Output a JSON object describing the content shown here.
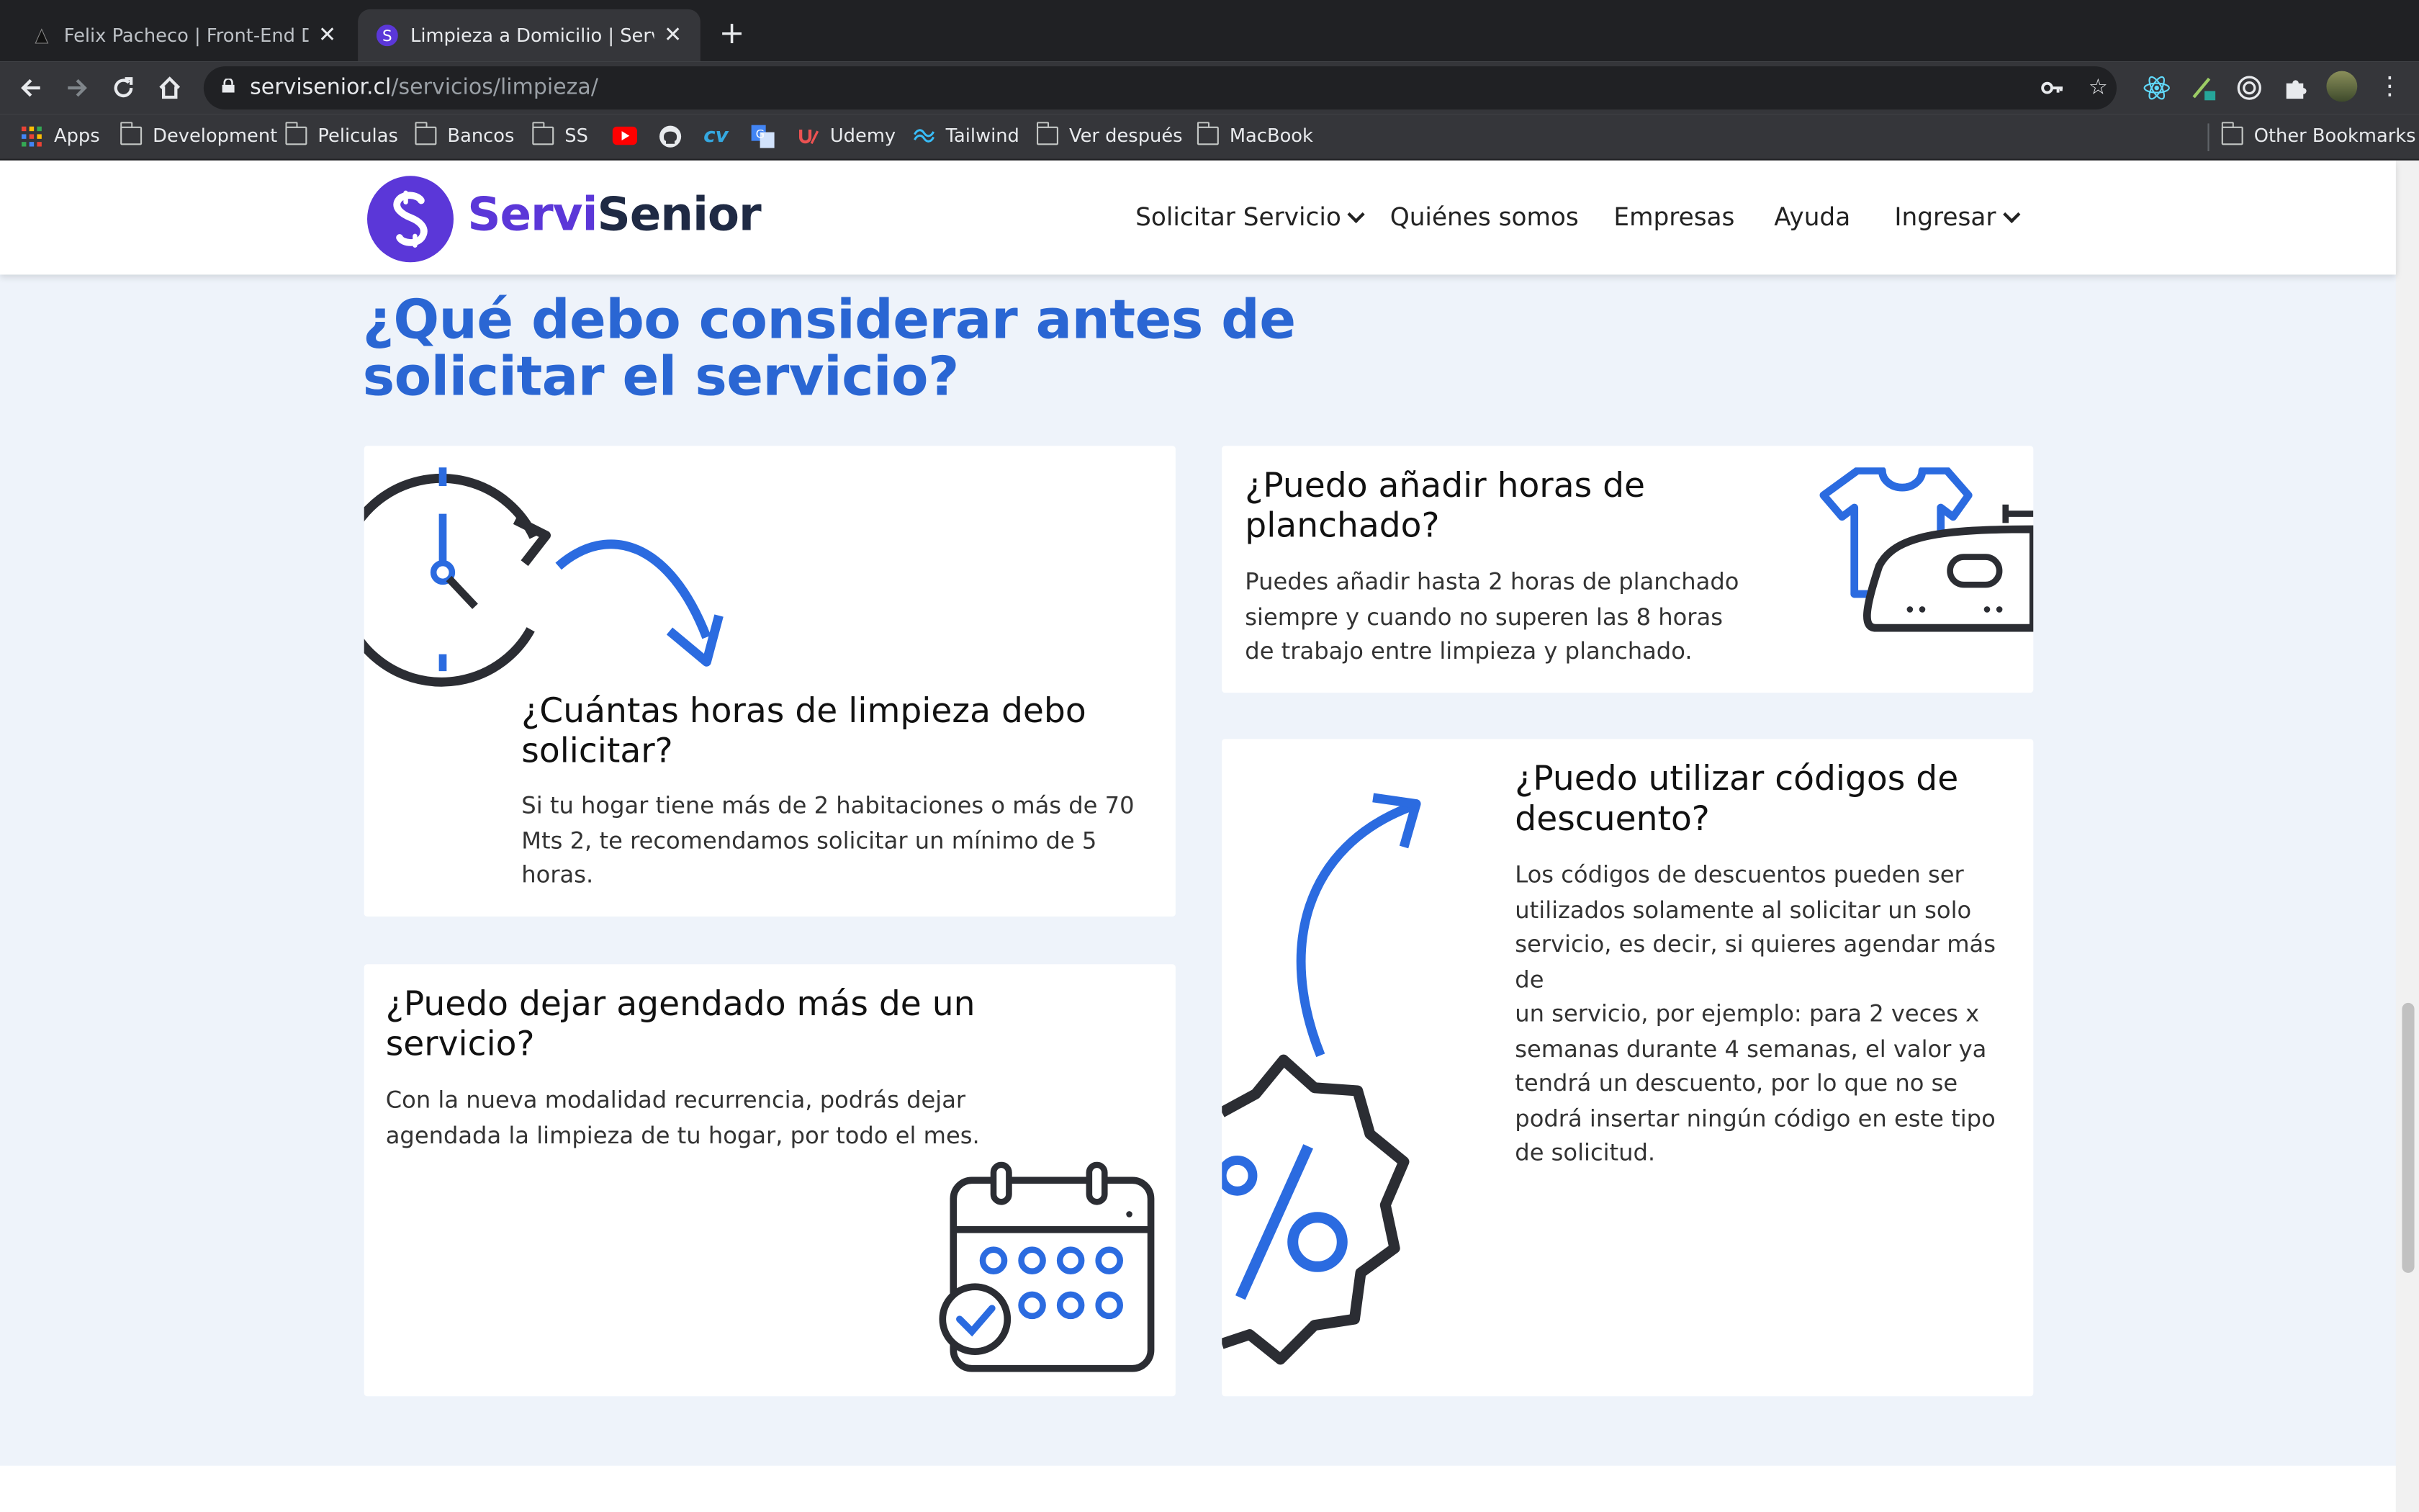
{
  "browser": {
    "tabs": [
      {
        "title": "Felix Pacheco | Front-End Deve",
        "active": false
      },
      {
        "title": "Limpieza a Domicilio | ServiSen",
        "active": true
      }
    ],
    "url_host": "servisenior.cl",
    "url_path": "/servicios/limpieza/",
    "bookmarks": [
      "Apps",
      "Development",
      "Peliculas",
      "Bancos",
      "SS",
      "Udemy",
      "Tailwind",
      "Ver después",
      "MacBook"
    ],
    "other_bookmarks": "Other Bookmarks"
  },
  "site": {
    "brand_part1": "Servi",
    "brand_part2": "Senior",
    "nav": [
      "Solicitar Servicio",
      "Quiénes somos",
      "Empresas",
      "Ayuda",
      "Ingresar"
    ]
  },
  "section": {
    "heading_line1": "¿Qué debo considerar antes de",
    "heading_line2": "solicitar el servicio?",
    "cards": [
      {
        "title_line1": "¿Cuántas horas de limpieza debo",
        "title_line2": "solicitar?",
        "text_lines": [
          "Si tu hogar tiene más de 2 habitaciones o más de 70",
          "Mts 2, te recomendamos solicitar un mínimo de 5",
          "horas."
        ]
      },
      {
        "title_line1": "¿Puedo añadir horas de",
        "title_line2": "planchado?",
        "text_lines": [
          "Puedes añadir hasta 2 horas de planchado",
          "siempre y cuando no superen las 8 horas",
          "de trabajo entre limpieza y planchado."
        ]
      },
      {
        "title_line1": "¿Puedo dejar agendado más de un",
        "title_line2": "servicio?",
        "text_lines": [
          "Con la nueva modalidad recurrencia, podrás dejar",
          "agendada la limpieza de tu hogar, por todo el mes."
        ]
      },
      {
        "title_line1": "¿Puedo utilizar códigos de",
        "title_line2": "descuento?",
        "text_lines": [
          "Los códigos de descuentos pueden ser",
          "utilizados solamente al solicitar un solo",
          "servicio, es decir, si quieres agendar más de",
          "un servicio, por ejemplo: para 2 veces x",
          "semanas durante 4 semanas, el valor ya",
          "tendrá un descuento, por lo que no se",
          "podrá insertar ningún código en este tipo",
          "de solicitud."
        ]
      }
    ]
  },
  "colors": {
    "accent": "#2a66d3",
    "brand": "#5b37d8",
    "icon_dark": "#2b2d33"
  }
}
